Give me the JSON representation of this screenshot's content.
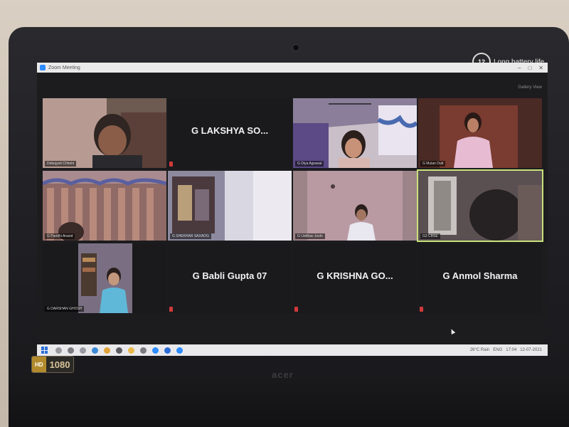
{
  "badge": {
    "battery_number": "12",
    "battery_text": "Long battery life"
  },
  "hd": {
    "left": "HD",
    "right": "1080"
  },
  "brand": "acer",
  "window": {
    "title": "Zoom Meeting",
    "view_label": "Gallery View"
  },
  "tiles": [
    {
      "name": "Debojyoti Chhetri",
      "display": "",
      "type": "video",
      "scene": "person-warm"
    },
    {
      "name": "",
      "display": "G LAKSHYA SO...",
      "type": "name-only"
    },
    {
      "name": "G Diya Agrawal",
      "display": "",
      "type": "video",
      "scene": "ceiling-purple"
    },
    {
      "name": "G Mulan Dutt",
      "display": "",
      "type": "video",
      "scene": "girl-red-room"
    },
    {
      "name": "G Paridhi Anand",
      "display": "",
      "type": "video",
      "scene": "curtain"
    },
    {
      "name": "G SHEKHAR SAXAOG",
      "display": "",
      "type": "video",
      "scene": "poster-wall"
    },
    {
      "name": "G Uddhav Joshi",
      "display": "",
      "type": "video",
      "scene": "boy-pink-wall"
    },
    {
      "name": "G3 CBSE",
      "display": "",
      "type": "video",
      "scene": "dark-window",
      "active": true
    },
    {
      "name": "G DARSHAN GHOSH",
      "display": "",
      "type": "video",
      "scene": "boy-shelf"
    },
    {
      "name": "",
      "display": "G Babli Gupta 07",
      "type": "name-only"
    },
    {
      "name": "",
      "display": "G KRISHNA GO...",
      "type": "name-only"
    },
    {
      "name": "",
      "display": "G Anmol Sharma",
      "type": "name-only"
    }
  ],
  "taskbar": {
    "tray_temp": "26°C Rain",
    "tray_lang": "ENG",
    "tray_time": "17:04",
    "tray_date": "12-07-2021"
  },
  "colors": {
    "meeting_bg": "#1c1c1f",
    "active_speaker": "#c9e27a",
    "muted": "#d23a3a"
  }
}
